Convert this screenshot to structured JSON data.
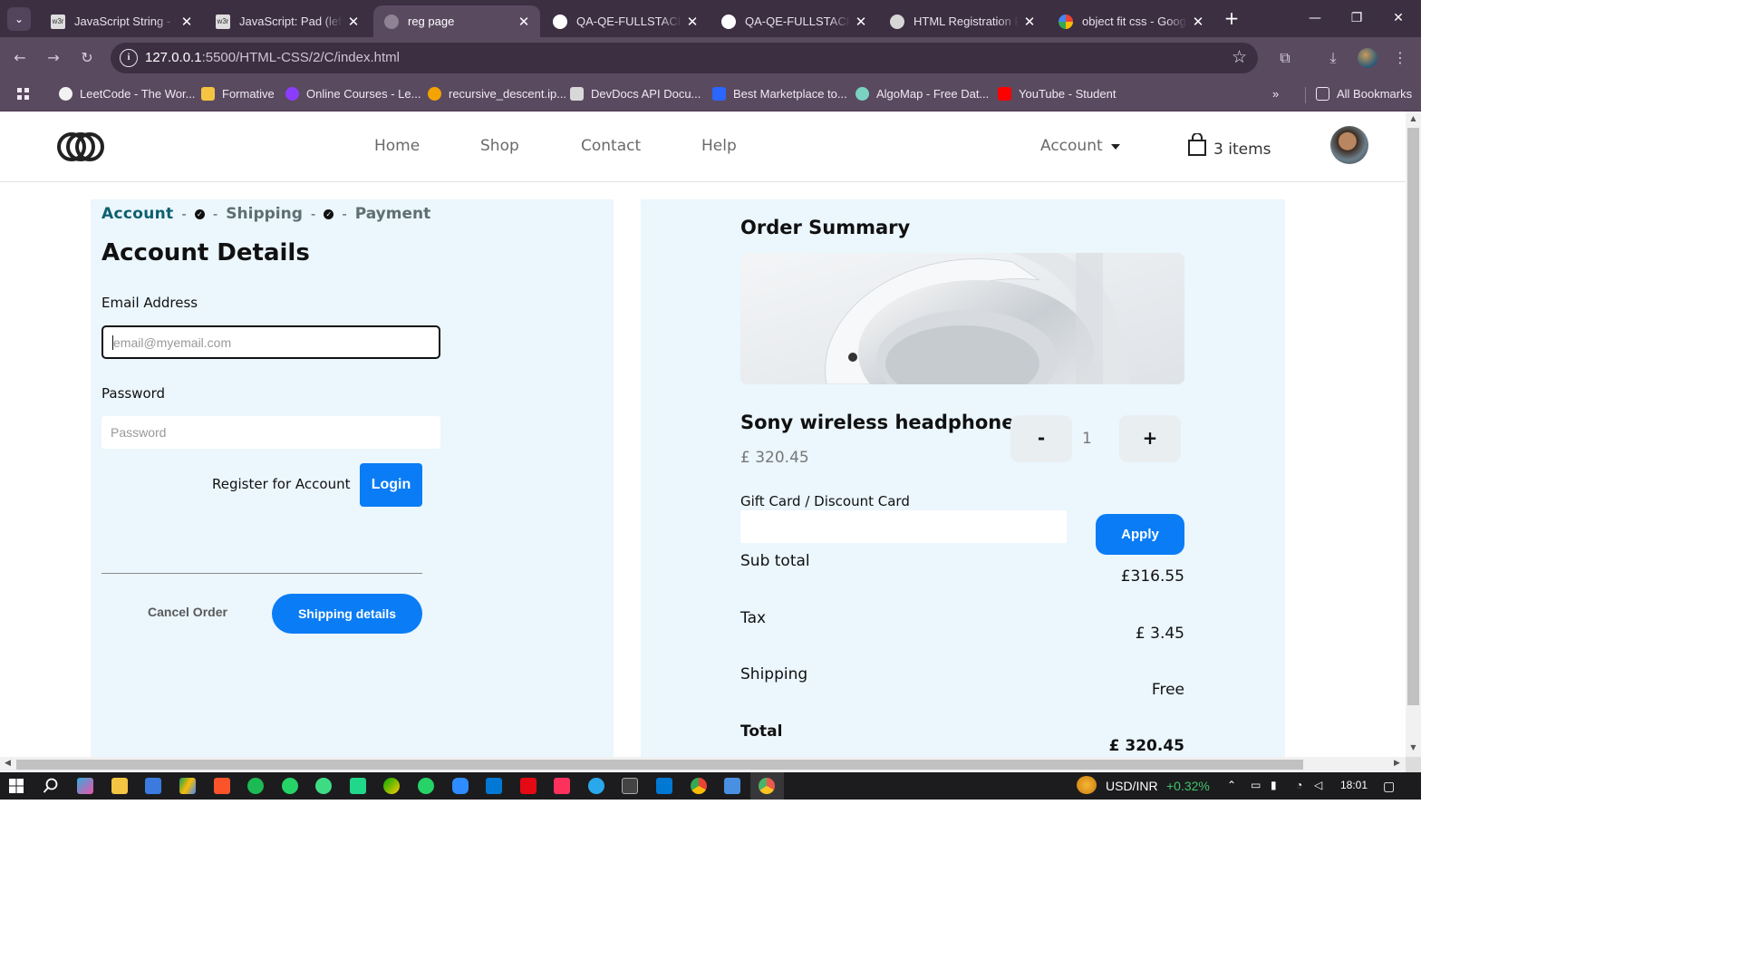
{
  "browser": {
    "tabs": [
      {
        "title": "JavaScript String - Ex",
        "favicon": "w3r",
        "color": "#e8e8e8"
      },
      {
        "title": "JavaScript: Pad (left, r",
        "favicon": "w3r",
        "color": "#e8e8e8"
      },
      {
        "title": "reg page",
        "favicon": "",
        "color": "#9a8fa0"
      },
      {
        "title": "QA-QE-FULLSTACK/h",
        "favicon": "",
        "color": "#ffffff"
      },
      {
        "title": "QA-QE-FULLSTACK/h",
        "favicon": "",
        "color": "#ffffff"
      },
      {
        "title": "HTML Registration Pa",
        "favicon": "",
        "color": "#dcdcdc"
      },
      {
        "title": "object fit css - Googl",
        "favicon": "",
        "color": "#4285f4"
      }
    ],
    "url_host": "127.0.0.1",
    "url_path": ":5500/HTML-CSS/2/C/index.html",
    "bookmarks": [
      {
        "label": "LeetCode - The Wor...",
        "color": "#f2f2f2"
      },
      {
        "label": "Formative",
        "color": "#f5c542"
      },
      {
        "label": "Online Courses - Le...",
        "color": "#8b3dff"
      },
      {
        "label": "recursive_descent.ip...",
        "color": "#f4a300"
      },
      {
        "label": "DevDocs API Docu...",
        "color": "#d8d8d8"
      },
      {
        "label": "Best Marketplace to...",
        "color": "#2a66ff"
      },
      {
        "label": "AlgoMap - Free Dat...",
        "color": "#7ad3c0"
      },
      {
        "label": "YouTube - Student",
        "color": "#ff0000"
      }
    ],
    "all_bookmarks": "All Bookmarks"
  },
  "nav": {
    "links": [
      "Home",
      "Shop",
      "Contact",
      "Help"
    ],
    "account": "Account",
    "cart_label": "3 items"
  },
  "account_panel": {
    "steps": {
      "account": "Account",
      "shipping": "Shipping",
      "payment": "Payment"
    },
    "title": "Account Details",
    "email_label": "Email Address",
    "email_placeholder": "email@myemail.com",
    "password_label": "Password",
    "password_placeholder": "Password",
    "register_link": "Register for Account",
    "login_button": "Login",
    "cancel_button": "Cancel Order",
    "shipping_button": "Shipping details"
  },
  "order_summary": {
    "title": "Order Summary",
    "product_name": "Sony wireless headphones",
    "product_price": "£ 320.45",
    "quantity": "1",
    "minus_label": "-",
    "plus_label": "+",
    "gift_label": "Gift Card / Discount Card",
    "apply_button": "Apply",
    "rows": [
      {
        "label": "Sub total",
        "value": "£316.55"
      },
      {
        "label": "Tax",
        "value": "£ 3.45"
      },
      {
        "label": "Shipping",
        "value": "Free"
      },
      {
        "label": "Total",
        "value": "£ 320.45"
      }
    ]
  },
  "taskbar": {
    "ticker": "USD/INR",
    "ticker_change": "+0.32%",
    "time": "18:01"
  },
  "colors": {
    "accent": "#0a7cf5",
    "panel_bg": "#ebf6fd",
    "step_active": "#0e5f6e",
    "chrome_dark": "#3c2f42",
    "chrome_toolbar": "#5a4a60"
  }
}
